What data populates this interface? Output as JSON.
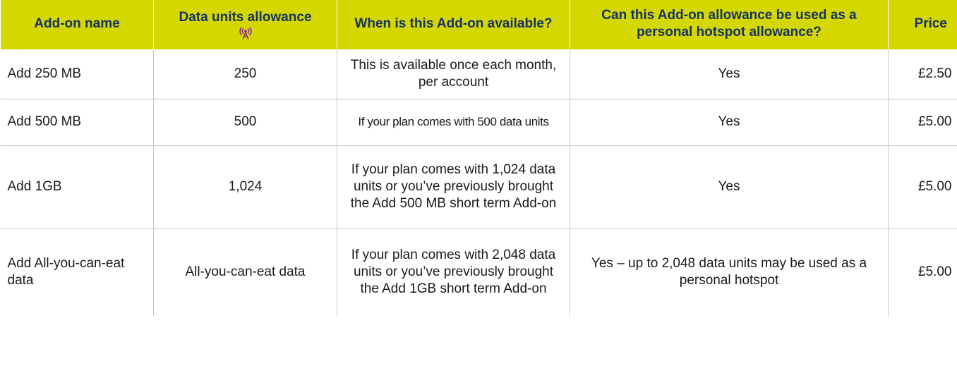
{
  "header": {
    "addon_name": "Add-on name",
    "data_units": "Data units allowance",
    "antenna_icon": "antenna-icon",
    "when_available": "When is this Add-on available?",
    "hotspot": "Can this Add-on allowance be used as a personal hotspot allowance?",
    "price": "Price"
  },
  "colors": {
    "header_bg": "#d4d700",
    "header_text": "#16316b",
    "icon": "#8a2a8f"
  },
  "rows": [
    {
      "name": "Add 250 MB",
      "units": "250",
      "available": "This is available once each month, per account",
      "hotspot": "Yes",
      "price": "£2.50"
    },
    {
      "name": "Add 500 MB",
      "units": "500",
      "available": "If your plan comes with 500 data units",
      "hotspot": "Yes",
      "price": "£5.00"
    },
    {
      "name": "Add 1GB",
      "units": "1,024",
      "available": "If your plan comes with 1,024 data units or you’ve previously brought the Add 500 MB short term Add-on",
      "hotspot": "Yes",
      "price": "£5.00"
    },
    {
      "name": "Add All-you-can-eat data",
      "units": "All-you-can-eat data",
      "available": "If your plan comes with 2,048 data units or you’ve previously brought the Add 1GB short term Add-on",
      "hotspot": "Yes – up to 2,048 data units may be used as a personal hotspot",
      "price": "£5.00"
    }
  ]
}
